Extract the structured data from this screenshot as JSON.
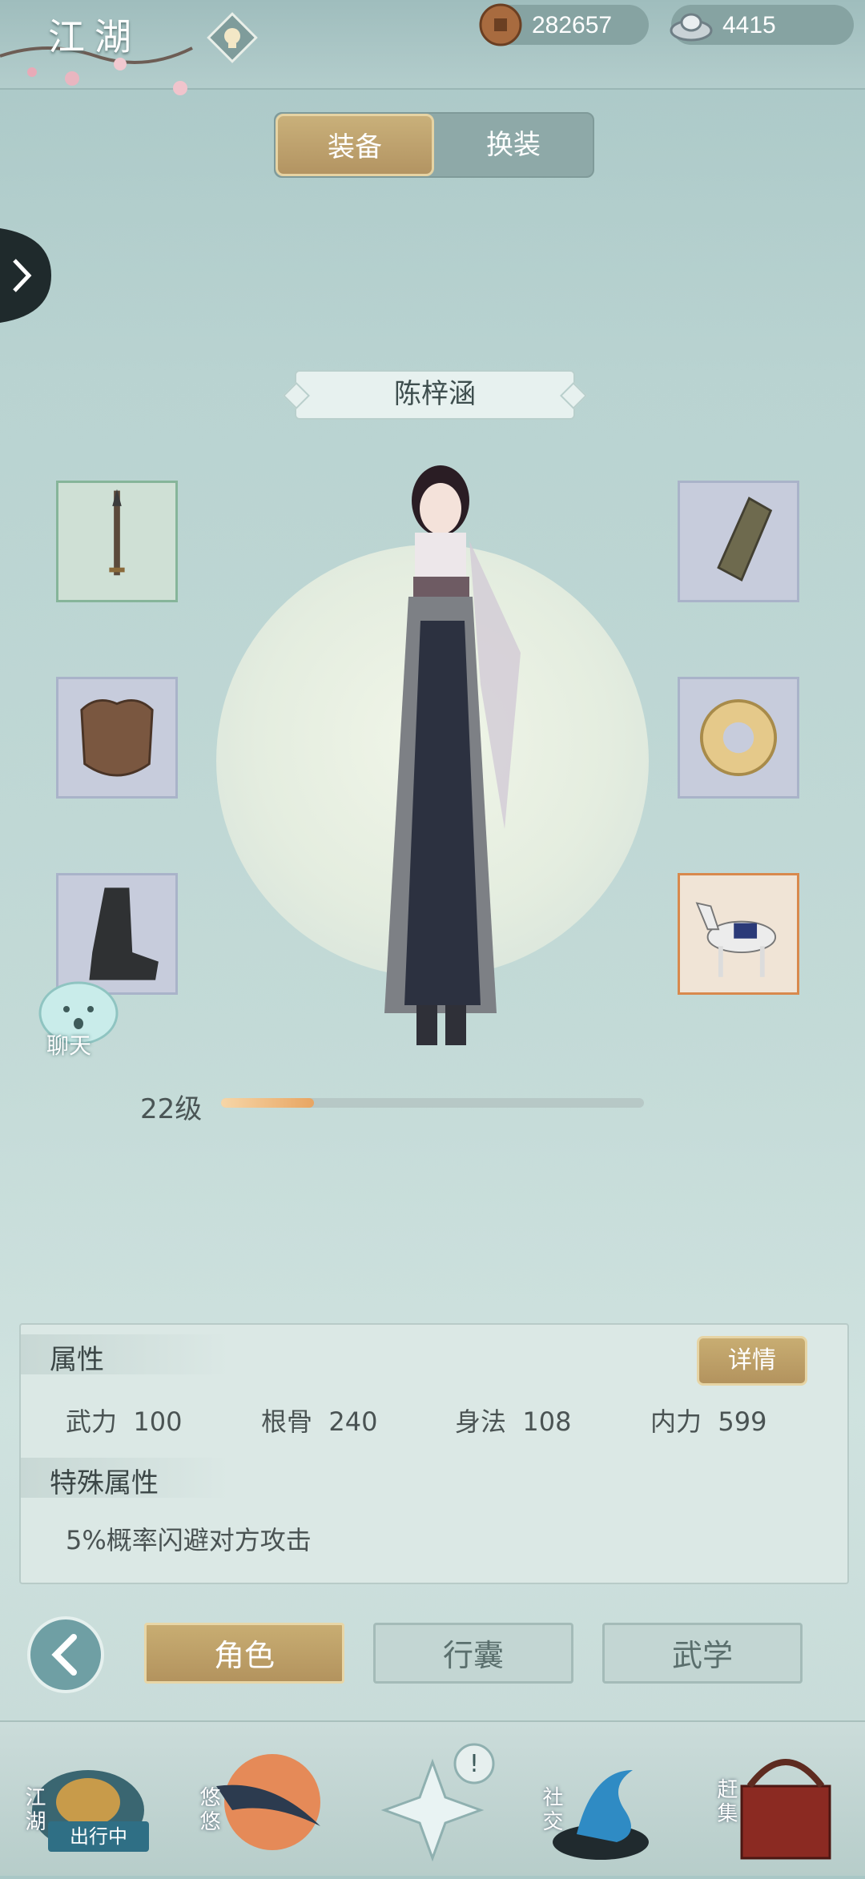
{
  "header": {
    "title": "江湖",
    "coins": "282657",
    "silver": "4415"
  },
  "tabs": [
    "装备",
    "换装"
  ],
  "character": {
    "name": "陈梓涵",
    "level_label": "22级",
    "level_progress": 0.22
  },
  "equipment_slots": [
    {
      "name": "weapon",
      "icon": "weapon-icon"
    },
    {
      "name": "armor",
      "icon": "armor-icon"
    },
    {
      "name": "boots",
      "icon": "boots-icon"
    },
    {
      "name": "bracer",
      "icon": "bracer-icon"
    },
    {
      "name": "accessory",
      "icon": "jade-pendant-icon"
    },
    {
      "name": "mount",
      "icon": "horse-icon"
    }
  ],
  "chat": {
    "label": "聊天"
  },
  "attributes": {
    "title": "属性",
    "detail_button": "详情",
    "stats": [
      {
        "label": "武力",
        "value": "100"
      },
      {
        "label": "根骨",
        "value": "240"
      },
      {
        "label": "身法",
        "value": "108"
      },
      {
        "label": "内力",
        "value": "599"
      }
    ],
    "special_title": "特殊属性",
    "special_text": "5%概率闪避对方攻击"
  },
  "bottom_buttons": [
    "角色",
    "行囊",
    "武学"
  ],
  "nav": {
    "jianghu": "江湖",
    "youyou": "悠悠",
    "social": "社交",
    "market": "赶集",
    "status": "出行中"
  }
}
